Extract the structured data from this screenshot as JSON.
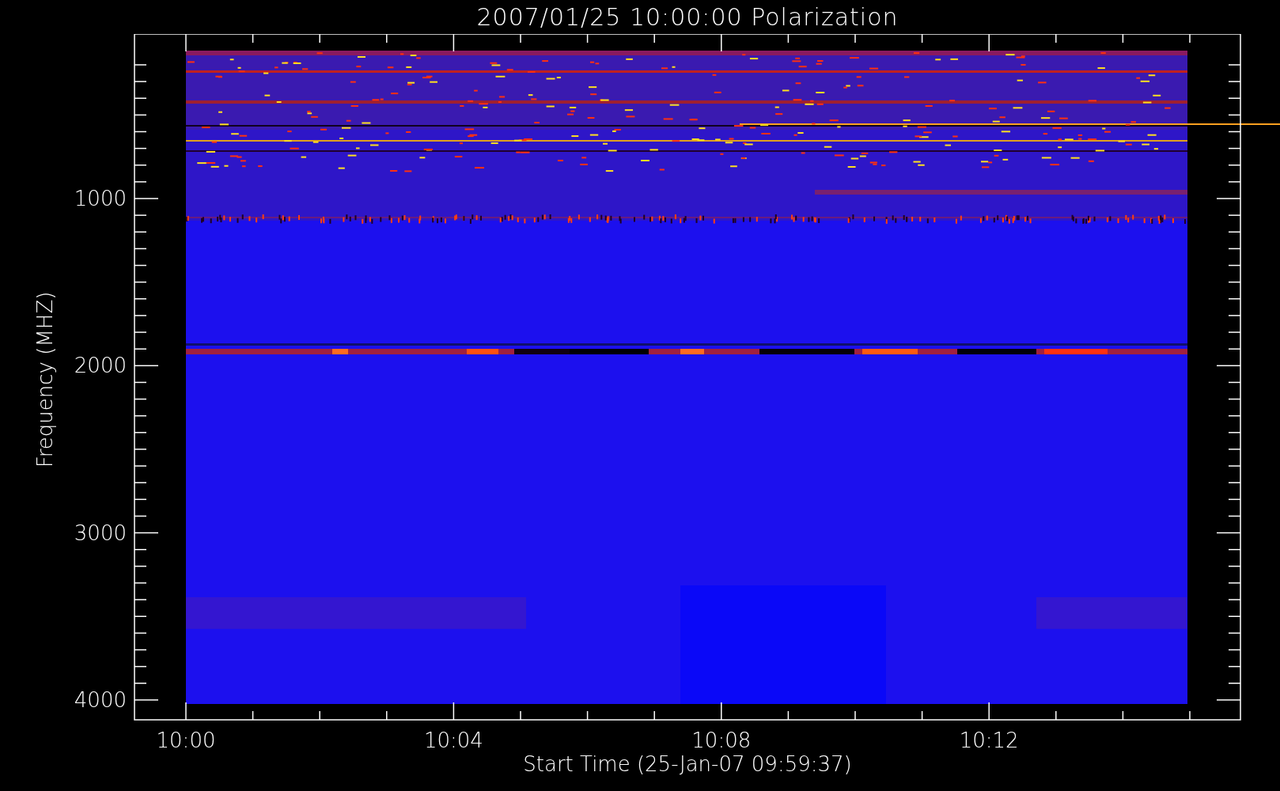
{
  "title": "2007/01/25 10:00:00 Polarization",
  "chart": {
    "ylabel": "Frequency (MHZ)",
    "xlabel": "Start Time (25-Jan-07 09:59:37)",
    "yticks": [
      "1000",
      "2000",
      "3000",
      "4000"
    ],
    "xticks": [
      "10:00",
      "10:04",
      "10:08",
      "10:12"
    ]
  }
}
